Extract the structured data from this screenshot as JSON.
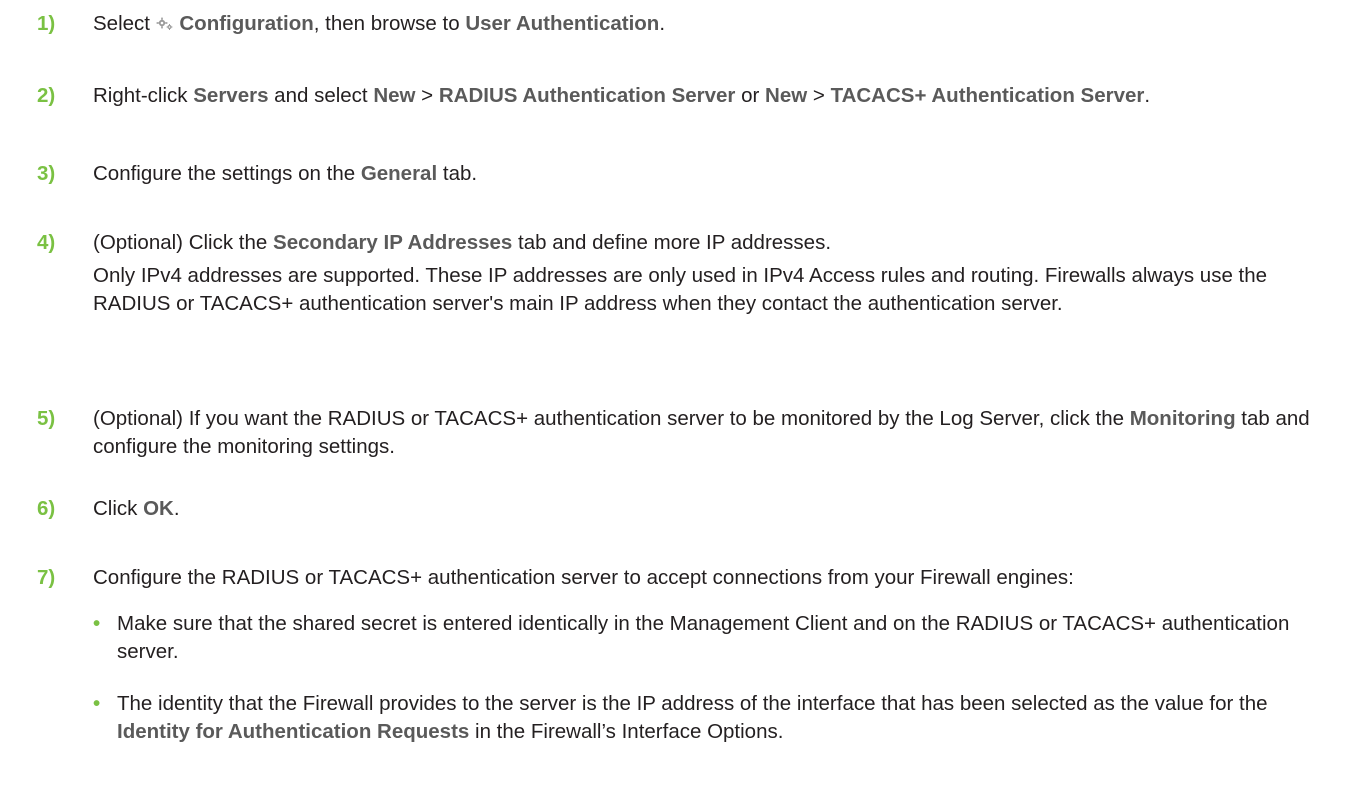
{
  "steps": [
    {
      "num": "1)",
      "parts": {
        "t1": "Select ",
        "b1": "Configuration",
        "t2": ", then browse to ",
        "b2": "User Authentication",
        "t3": "."
      },
      "icon": "gear-icon"
    },
    {
      "num": "2)",
      "parts": {
        "t1": "Right-click ",
        "b1": "Servers",
        "t2": " and select ",
        "b2": "New",
        "t3": " > ",
        "b3": "RADIUS Authentication Server",
        "t4": " or ",
        "b4": "New",
        "t5": " > ",
        "b5": "TACACS+ Authentication Server",
        "t6": "."
      }
    },
    {
      "num": "3)",
      "parts": {
        "t1": "Configure the settings on the ",
        "b1": "General",
        "t2": " tab."
      }
    },
    {
      "num": "4)",
      "parts": {
        "t1": "(Optional) Click the ",
        "b1": "Secondary IP Addresses",
        "t2": " tab and define more IP addresses."
      },
      "note": "Only IPv4 addresses are supported. These IP addresses are only used in IPv4 Access rules and routing. Firewalls always use the RADIUS or TACACS+ authentication server's main IP address when they contact the authentication server."
    },
    {
      "num": "5)",
      "parts": {
        "t1": "(Optional) If you want the RADIUS or TACACS+ authentication server to be monitored by the Log Server, click the ",
        "b1": "Monitoring",
        "t2": " tab and configure the monitoring settings."
      }
    },
    {
      "num": "6)",
      "parts": {
        "t1": "Click ",
        "b1": "OK",
        "t2": "."
      }
    },
    {
      "num": "7)",
      "parts": {
        "t1": "Configure the RADIUS or TACACS+ authentication server to accept connections from your Firewall engines:"
      },
      "bullets": [
        {
          "dot": "•",
          "t1": "Make sure that the shared secret is entered identically in the Management Client and on the RADIUS or TACACS+ authentication server."
        },
        {
          "dot": "•",
          "t1": "The identity that the Firewall provides to the server is the IP address of the interface that has been selected as the value for the ",
          "b1": "Identity for Authentication Requests",
          "t2": " in the Firewall’s Interface Options."
        }
      ]
    }
  ],
  "colors": {
    "step_number": "#7ac143",
    "text": "#231f20",
    "bold_term": "#5a5a5a",
    "icon": "#9a9a9a"
  }
}
